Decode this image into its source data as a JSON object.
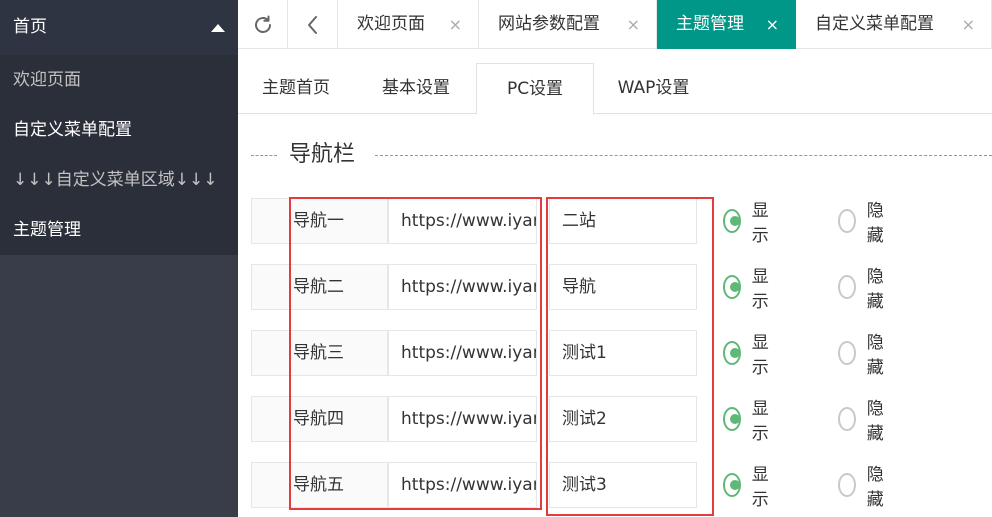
{
  "sidebar": {
    "header": "首页",
    "items": [
      {
        "label": "欢迎页面",
        "dim": true
      },
      {
        "label": "自定义菜单配置"
      },
      {
        "label": "↓↓↓自定义菜单区域↓↓↓",
        "dim": true
      },
      {
        "label": "主题管理"
      }
    ]
  },
  "tabs": [
    {
      "label": "欢迎页面"
    },
    {
      "label": "网站参数配置"
    },
    {
      "label": "主题管理",
      "active": true
    },
    {
      "label": "自定义菜单配置"
    }
  ],
  "tab_close_glyph": "×",
  "icons": {
    "refresh": "refresh-icon",
    "back": "chevron-left-icon"
  },
  "subtabs": [
    {
      "label": "主题首页"
    },
    {
      "label": "基本设置"
    },
    {
      "label": "PC设置",
      "active": true
    },
    {
      "label": "WAP设置"
    }
  ],
  "section_title": "导航栏",
  "nav_rows": [
    {
      "label": "导航一",
      "url": "https://www.iyans",
      "name": "二站",
      "show": true
    },
    {
      "label": "导航二",
      "url": "https://www.iyans",
      "name": "导航",
      "show": true
    },
    {
      "label": "导航三",
      "url": "https://www.iyans",
      "name": "测试1",
      "show": true
    },
    {
      "label": "导航四",
      "url": "https://www.iyans",
      "name": "测试2",
      "show": true
    },
    {
      "label": "导航五",
      "url": "https://www.iyans",
      "name": "测试3",
      "show": true
    }
  ],
  "radio_labels": {
    "show": "显示",
    "hide": "隐藏"
  },
  "colors": {
    "accent": "#009688",
    "radio": "#5fb878",
    "highlight": "#e23c3c",
    "sidebar": "#393d49"
  }
}
